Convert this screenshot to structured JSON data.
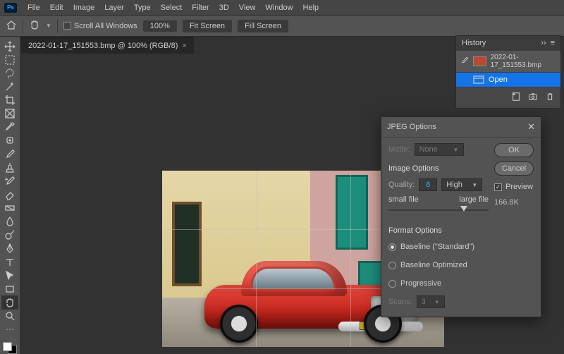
{
  "app": {
    "logo": "Ps"
  },
  "menu": [
    "File",
    "Edit",
    "Image",
    "Layer",
    "Type",
    "Select",
    "Filter",
    "3D",
    "View",
    "Window",
    "Help"
  ],
  "options": {
    "scroll_all": "Scroll All Windows",
    "zoom": "100%",
    "fit": "Fit Screen",
    "fill": "Fill Screen"
  },
  "tab": {
    "title": "2022-01-17_151553.bmp @ 100% (RGB/8)"
  },
  "history": {
    "title": "History",
    "file": "2022-01-17_151553.bmp",
    "state": "Open"
  },
  "dialog": {
    "title": "JPEG Options",
    "matte_label": "Matte:",
    "matte_value": "None",
    "image_options": "Image Options",
    "quality_label": "Quality:",
    "quality_value": "8",
    "quality_preset": "High",
    "slider_small": "small file",
    "slider_large": "large file",
    "format_options": "Format Options",
    "radio_standard": "Baseline (\"Standard\")",
    "radio_optimized": "Baseline Optimized",
    "radio_progressive": "Progressive",
    "scans_label": "Scans:",
    "scans_value": "3",
    "ok": "OK",
    "cancel": "Cancel",
    "preview": "Preview",
    "filesize": "166.8K"
  }
}
